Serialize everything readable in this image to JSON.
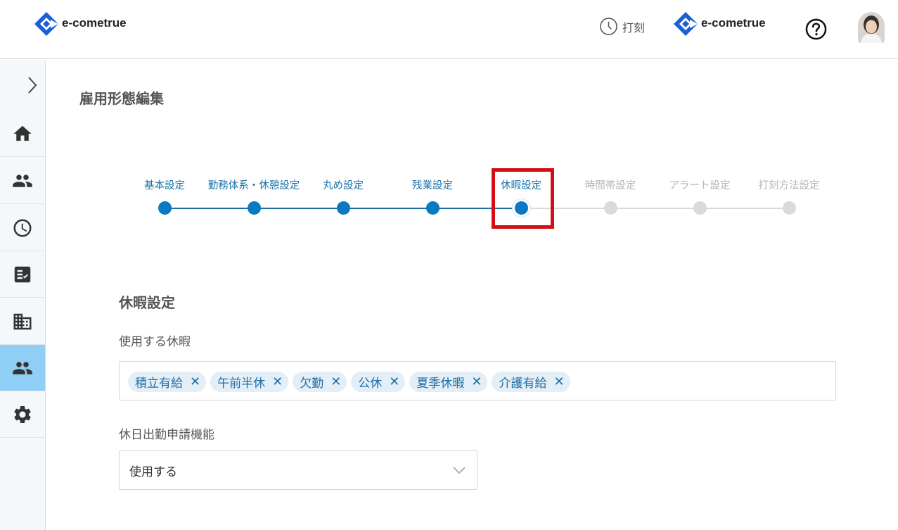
{
  "header": {
    "logo_text_left": "e-cometrue",
    "logo_text_right": "e-cometrue",
    "punch_label": "打刻",
    "icons": [
      "clock-icon",
      "help-icon",
      "avatar"
    ]
  },
  "sidebar": {
    "items": [
      "home-icon",
      "people-icon",
      "clock-icon",
      "checklist-icon",
      "building-icon",
      "people-icon",
      "gear-icon"
    ],
    "active_index": 5
  },
  "page": {
    "title": "雇用形態編集"
  },
  "stepper": {
    "steps": [
      {
        "label": "基本設定",
        "state": "done"
      },
      {
        "label": "勤務体系・休憩設定",
        "state": "done"
      },
      {
        "label": "丸め設定",
        "state": "done"
      },
      {
        "label": "残業設定",
        "state": "done"
      },
      {
        "label": "休暇設定",
        "state": "current"
      },
      {
        "label": "時間帯設定",
        "state": "todo"
      },
      {
        "label": "アラート設定",
        "state": "todo"
      },
      {
        "label": "打刻方法設定",
        "state": "todo"
      }
    ]
  },
  "form": {
    "section_title": "休暇設定",
    "vacation_label": "使用する休暇",
    "vacation_tags": [
      "積立有給",
      "午前半休",
      "欠勤",
      "公休",
      "夏季休暇",
      "介護有給"
    ],
    "tag_remove_symbol": "✕",
    "holiday_label": "休日出勤申請機能",
    "holiday_value": "使用する"
  },
  "colors": {
    "accent": "#0a79c2",
    "highlight": "#d40d15",
    "sidebar_active": "#8fcff5",
    "tag_bg": "#e4eef6"
  }
}
